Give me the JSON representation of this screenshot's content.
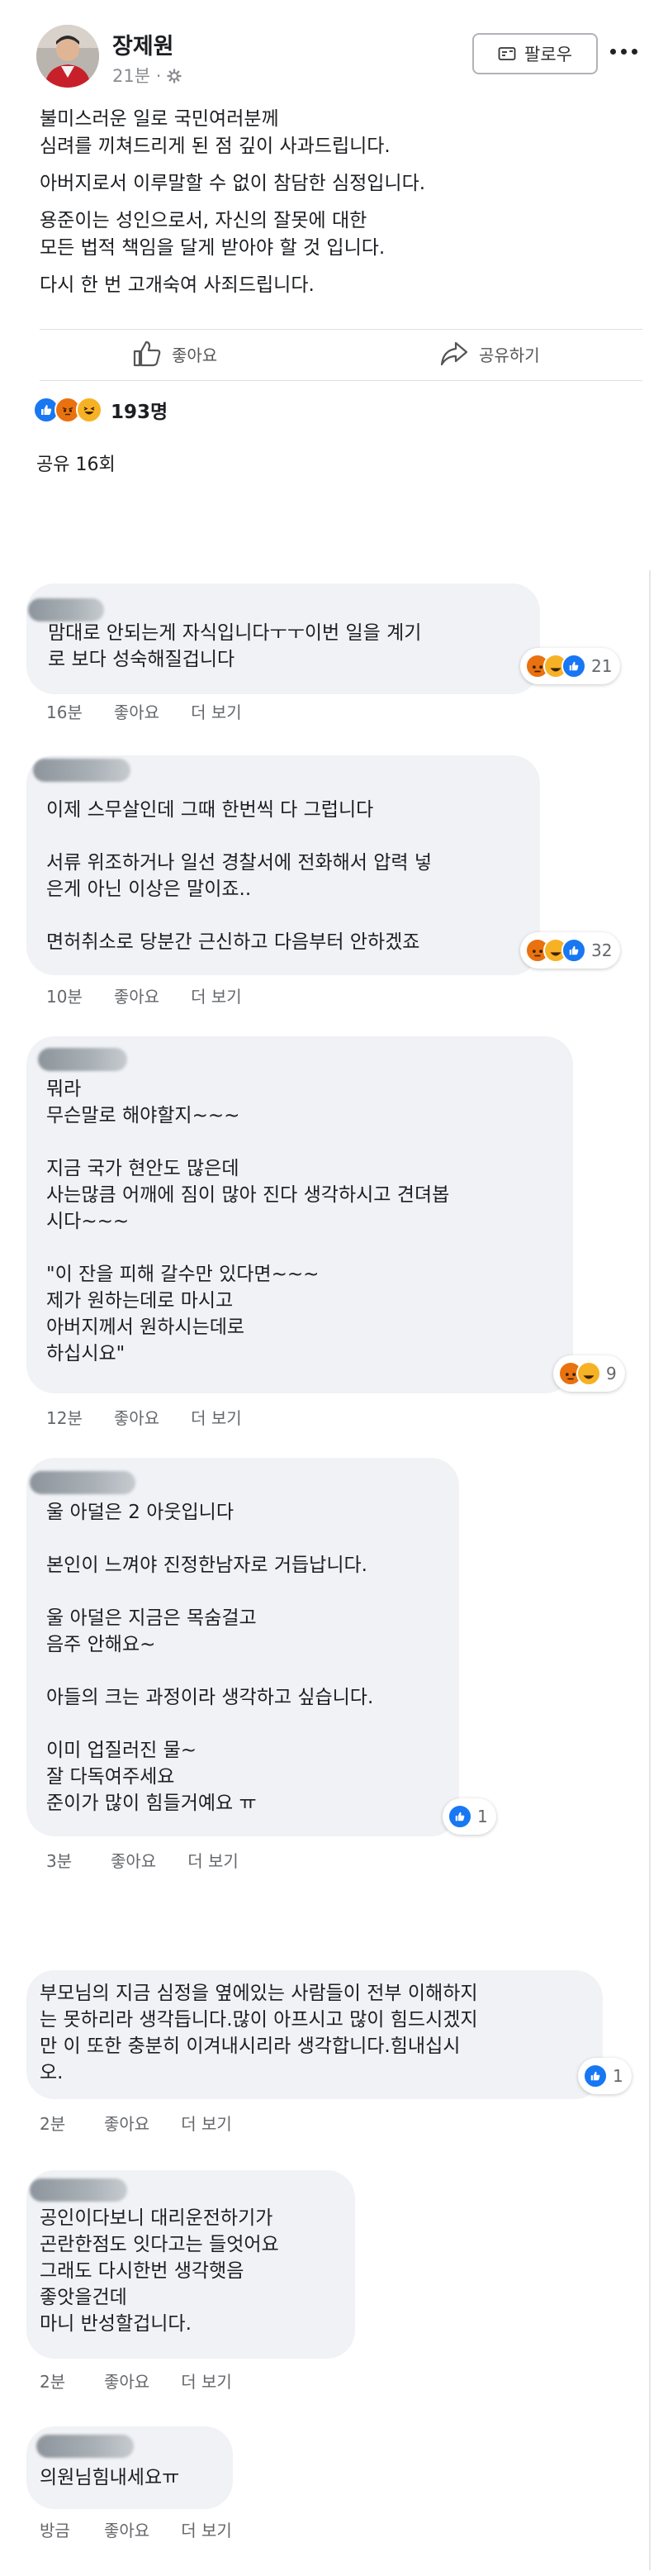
{
  "header": {
    "author": "장제원",
    "time": "21분 · ",
    "follow_label": "팔로우"
  },
  "post": {
    "paragraphs": [
      "불미스러운 일로 국민여러분께\n심려를 끼쳐드리게 된 점 깊이 사과드립니다.",
      "아버지로서 이루말할 수 없이 참담한 심정입니다.",
      "용준이는 성인으로서, 자신의 잘못에 대한\n모든 법적 책임을 달게 받아야 할 것 입니다.",
      "다시 한 번 고개숙여 사죄드립니다."
    ]
  },
  "actions": {
    "like": "좋아요",
    "share": "공유하기"
  },
  "reactions": {
    "count": "193명"
  },
  "shares": {
    "label": "공유 16회"
  },
  "colors": {
    "like": "#1877f2",
    "angry": "#e9710f",
    "haha": "#f7b125",
    "bubble": "#f0f2f5"
  },
  "comment_actions": {
    "like": "좋아요",
    "more": "더 보기"
  },
  "comments": [
    {
      "text": "맘대로 안되는게 자식입니다ㅜㅜ이번 일을 계기\n로 보다 성숙해질겁니다",
      "age": "16분",
      "reaction_count": "21"
    },
    {
      "text": "이제 스무살인데 그때 한번씩 다 그럽니다\n\n서류 위조하거나 일선 경찰서에 전화해서 압력 넣\n은게 아닌 이상은 말이죠..\n\n면허취소로 당분간 근신하고 다음부터 안하겠죠",
      "age": "10분",
      "reaction_count": "32"
    },
    {
      "text": "뭐라\n무슨말로 해야할지~~~\n\n지금 국가 현안도 많은데\n사는많큼 어깨에 짐이 많아 진다 생각하시고 견뎌봅\n시다~~~\n\n\"이 잔을 피해 갈수만 있다면~~~\n제가 원하는데로 마시고\n아버지께서 원하시는데로\n하십시요\"",
      "age": "12분",
      "reaction_count": "9"
    },
    {
      "text": "울 아덜은 2 아웃입니다\n\n본인이 느껴야 진정한남자로 거듭납니다.\n\n울 아덜은 지금은 목숨걸고\n음주 안해요~\n\n아들의 크는 과정이라 생각하고 싶습니다.\n\n이미 업질러진 물~\n잘 다독여주세요\n준이가 많이 힘들거예요 ㅠ",
      "age": "3분",
      "reaction_count": "1"
    },
    {
      "text": "부모님의 지금 심정을 옆에있는 사람들이 전부 이해하지\n는 못하리라 생각듭니다.많이 아프시고 많이 힘드시겠지\n만 이 또한 충분히 이겨내시리라 생각합니다.힘내십시\n오.",
      "age": "2분",
      "reaction_count": "1"
    },
    {
      "text": "공인이다보니 대리운전하기가\n곤란한점도 잇다고는 들엇어요\n그래도 다시한번 생각햇음\n좋앗을건데\n마니 반성할겁니다.",
      "age": "2분",
      "reaction_count": ""
    },
    {
      "text": "의원님힘내세요ㅠ",
      "age": "방금",
      "reaction_count": ""
    }
  ]
}
